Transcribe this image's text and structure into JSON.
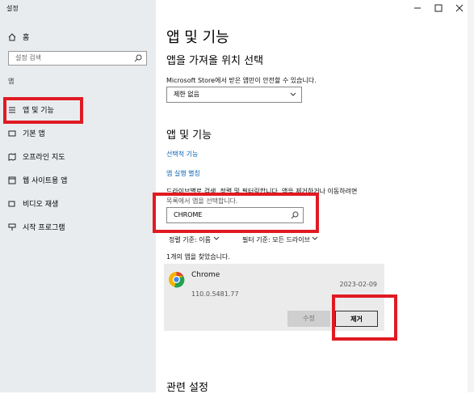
{
  "window": {
    "title": "설정"
  },
  "sidebar": {
    "home": "홈",
    "search_placeholder": "설정 검색",
    "section": "앱",
    "items": [
      {
        "label": "앱 및 기능"
      },
      {
        "label": "기본 앱"
      },
      {
        "label": "오프라인 지도"
      },
      {
        "label": "웹 사이트용 앱"
      },
      {
        "label": "비디오 재생"
      },
      {
        "label": "시작 프로그램"
      }
    ]
  },
  "main": {
    "title": "앱 및 기능",
    "choose_location_heading": "앱을 가져올 위치 선택",
    "store_warning": "Microsoft Store에서 받은 앱만이 안전할 수 있습니다.",
    "restriction_value": "제한 없음",
    "apps_heading": "앱 및 기능",
    "optional_features_link": "선택적 기능",
    "app_execution_alias_link": "앱 실행 별칭",
    "search_help_line1": "드라이브별로 검색, 정렬 및 필터링합니다. 앱을 제거하거나 이동하려면",
    "search_help_line2": "목록에서 앱을 선택합니다.",
    "search_value": "CHROME",
    "sort_label": "정렬 기준: 이름",
    "filter_label": "필터 기준: 모든 드라이브",
    "result_count": "1개의 앱을 찾았습니다.",
    "app": {
      "name": "Chrome",
      "date": "2023-02-09",
      "version": "110.0.5481.77"
    },
    "modify_button": "수정",
    "uninstall_button": "제거",
    "related_settings": "관련 설정"
  },
  "colors": {
    "highlight": "#e01a22",
    "link": "#0a62b5",
    "sidebar_bg": "#e9ecef"
  }
}
